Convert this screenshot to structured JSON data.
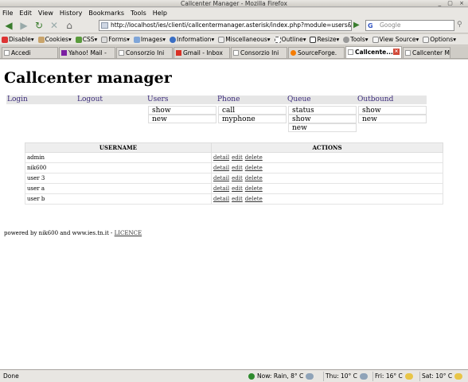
{
  "window": {
    "title": "Callcenter Manager - Mozilla Firefox",
    "controls": "_ ▢ ×"
  },
  "menu": [
    "File",
    "Edit",
    "View",
    "History",
    "Bookmarks",
    "Tools",
    "Help"
  ],
  "navigation": {
    "url": "http://localhost/ies/clienti/callcentermanager.asterisk/index.php?module=users&act",
    "search_placeholder": "Google",
    "back_icon": "back-arrow-icon",
    "forward_icon": "forward-arrow-icon"
  },
  "toolbar": {
    "items": [
      "Disable",
      "Cookies",
      "CSS",
      "Forms",
      "Images",
      "Information",
      "Miscellaneous",
      "Outline",
      "Resize",
      "Tools",
      "View Source",
      "Options"
    ]
  },
  "tabs": [
    {
      "label": "Accedi",
      "active": false
    },
    {
      "label": "Yahoo! Mail -",
      "active": false
    },
    {
      "label": "Consorzio Ini",
      "active": false
    },
    {
      "label": "Gmail - Inbox",
      "active": false
    },
    {
      "label": "Consorzio Ini",
      "active": false
    },
    {
      "label": "SourceForge.",
      "active": false
    },
    {
      "label": "Callcente...",
      "active": true
    },
    {
      "label": "Callcenter M",
      "active": false
    }
  ],
  "page": {
    "heading": "Callcenter manager",
    "nav": {
      "login": "Login",
      "logout": "Logout",
      "users": {
        "title": "Users",
        "items": [
          "show",
          "new"
        ]
      },
      "phone": {
        "title": "Phone",
        "items": [
          "call",
          "myphone"
        ]
      },
      "queue": {
        "title": "Queue",
        "items": [
          "status",
          "show",
          "new"
        ]
      },
      "outbound": {
        "title": "Outbound",
        "items": [
          "show",
          "new"
        ]
      }
    },
    "table": {
      "headers": [
        "USERNAME",
        "ACTIONS"
      ],
      "rows": [
        {
          "username": "admin"
        },
        {
          "username": "nik600"
        },
        {
          "username": "user 3"
        },
        {
          "username": "user a"
        },
        {
          "username": "user b"
        }
      ],
      "actions": [
        "detail",
        "edit",
        "delete"
      ]
    },
    "footer": {
      "text": "powered by nik600 and www.ies.tn.it - ",
      "licence": "LICENCE"
    }
  },
  "status": {
    "text": "Done",
    "weather": [
      {
        "label": "Now: Rain, 8° C"
      },
      {
        "label": "Thu: 10° C"
      },
      {
        "label": "Fri: 16° C"
      },
      {
        "label": "Sat: 10° C"
      }
    ]
  }
}
